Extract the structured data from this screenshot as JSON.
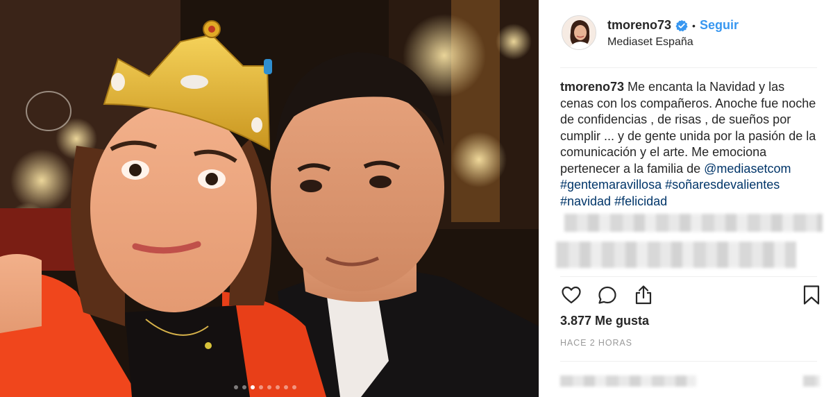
{
  "photo": {
    "alt": "",
    "carousel": {
      "count": 8,
      "active_index": 2
    }
  },
  "header": {
    "username": "tmoreno73",
    "verified_icon": "verified-badge-icon",
    "separator": "•",
    "follow_label": "Seguir",
    "location": "Mediaset España"
  },
  "caption": {
    "username": "tmoreno73",
    "text": "Me encanta la Navidad y las cenas con los compañeros. Anoche fue noche de confidencias , de risas , de sueños por cumplir ... y de gente unida por la pasión de la comunicación y el arte. Me emociona pertenecer a la familia de",
    "mention": "@mediasetcom",
    "hashtags": [
      "#gentemaravillosa",
      "#soñaresdevalientes",
      "#navidad",
      "#felicidad"
    ]
  },
  "actions": {
    "like_icon": "heart-icon",
    "comment_icon": "comment-icon",
    "share_icon": "share-icon",
    "save_icon": "bookmark-icon"
  },
  "likes": "3.877 Me gusta",
  "timestamp": "HACE 2 HORAS",
  "colors": {
    "link": "#3897f0",
    "hashtag": "#003569",
    "text": "#262626",
    "muted": "#999999",
    "border": "#efefef",
    "jacket": "#f0461c"
  }
}
